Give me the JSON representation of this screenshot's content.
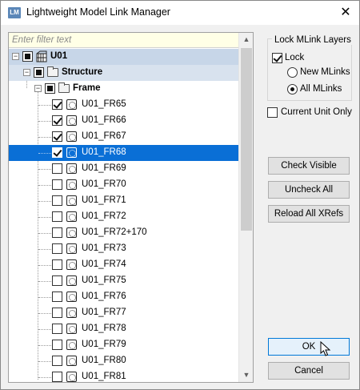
{
  "window": {
    "icon_text": "LM",
    "title": "Lightweight Model Link Manager",
    "close_glyph": "✕"
  },
  "tree": {
    "filter_placeholder": "Enter filter text",
    "root": {
      "label": "U01",
      "expander": "−"
    },
    "structure": {
      "label": "Structure",
      "expander": "−"
    },
    "frame": {
      "label": "Frame",
      "expander": "−"
    },
    "items": [
      {
        "label": "U01_FR65",
        "checked": true
      },
      {
        "label": "U01_FR66",
        "checked": true
      },
      {
        "label": "U01_FR67",
        "checked": true
      },
      {
        "label": "U01_FR68",
        "checked": true,
        "selected": true
      },
      {
        "label": "U01_FR69",
        "checked": false
      },
      {
        "label": "U01_FR70",
        "checked": false
      },
      {
        "label": "U01_FR71",
        "checked": false
      },
      {
        "label": "U01_FR72",
        "checked": false
      },
      {
        "label": "U01_FR72+170",
        "checked": false
      },
      {
        "label": "U01_FR73",
        "checked": false
      },
      {
        "label": "U01_FR74",
        "checked": false
      },
      {
        "label": "U01_FR75",
        "checked": false
      },
      {
        "label": "U01_FR76",
        "checked": false
      },
      {
        "label": "U01_FR77",
        "checked": false
      },
      {
        "label": "U01_FR78",
        "checked": false
      },
      {
        "label": "U01_FR79",
        "checked": false
      },
      {
        "label": "U01_FR80",
        "checked": false
      },
      {
        "label": "U01_FR81",
        "checked": false
      }
    ],
    "scroll_up_glyph": "▲",
    "scroll_down_glyph": "▼"
  },
  "lock_group": {
    "title": "Lock MLink Layers",
    "lock_label": "Lock",
    "lock_checked": true,
    "new_mlinks_label": "New MLinks",
    "all_mlinks_label": "All MLinks",
    "selected_option": "All MLinks"
  },
  "current_unit_only": {
    "label": "Current Unit Only",
    "checked": false
  },
  "buttons": {
    "check_visible": "Check Visible",
    "uncheck_all": "Uncheck All",
    "reload_all_xrefs": "Reload All XRefs",
    "ok": "OK",
    "cancel": "Cancel"
  },
  "colors": {
    "selection": "#0a6fd6",
    "root_highlight": "#c7d6e8",
    "filter_background": "#ffffe6",
    "default_button_border": "#0078d7"
  }
}
